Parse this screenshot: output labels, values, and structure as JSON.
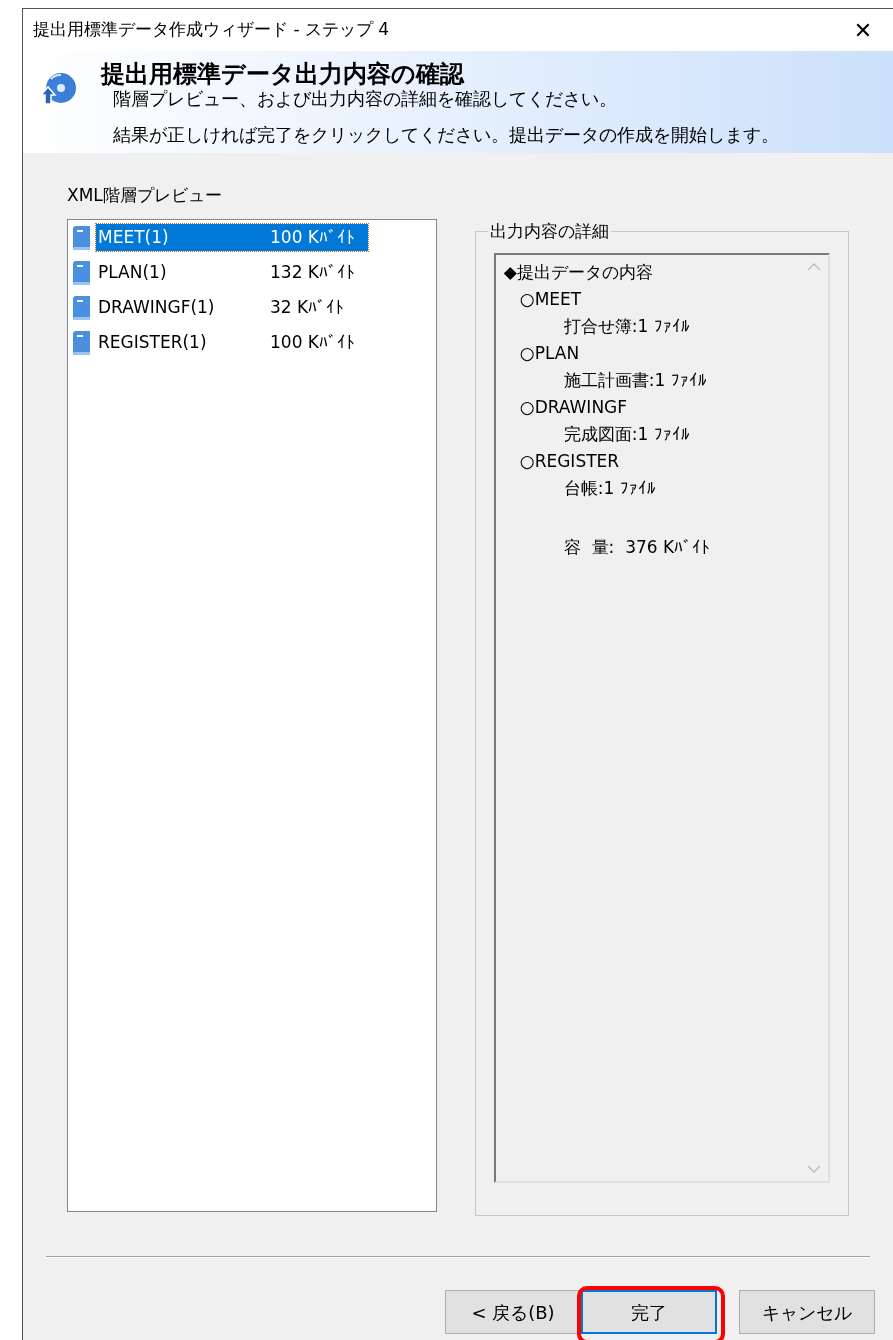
{
  "window": {
    "title": "提出用標準データ作成ウィザード - ステップ 4",
    "close": "✕"
  },
  "header": {
    "title": "提出用標準データ出力内容の確認",
    "lines": [
      "階層プレビュー、および出力内容の詳細を確認してください。",
      "結果が正しければ完了をクリックしてください。提出データの作成を開始します。"
    ]
  },
  "tree": {
    "label": "XML階層プレビュー",
    "items": [
      {
        "name": "MEET(1)",
        "size": "100 Kﾊﾞｲﾄ",
        "selected": true
      },
      {
        "name": "PLAN(1)",
        "size": "132 Kﾊﾞｲﾄ",
        "selected": false
      },
      {
        "name": "DRAWINGF(1)",
        "size": "32 Kﾊﾞｲﾄ",
        "selected": false
      },
      {
        "name": "REGISTER(1)",
        "size": "100 Kﾊﾞｲﾄ",
        "selected": false
      }
    ]
  },
  "details": {
    "label": "出力内容の詳細",
    "lines": [
      {
        "kind": "heading",
        "text": "◆提出データの内容"
      },
      {
        "kind": "group",
        "text": "○MEET"
      },
      {
        "kind": "item",
        "text": "打合せ簿:1 ﾌｧｲﾙ"
      },
      {
        "kind": "group",
        "text": "○PLAN"
      },
      {
        "kind": "item",
        "text": "施工計画書:1 ﾌｧｲﾙ"
      },
      {
        "kind": "group",
        "text": "○DRAWINGF"
      },
      {
        "kind": "item",
        "text": "完成図面:1 ﾌｧｲﾙ"
      },
      {
        "kind": "group",
        "text": "○REGISTER"
      },
      {
        "kind": "item",
        "text": "台帳:1 ﾌｧｲﾙ"
      },
      {
        "kind": "total",
        "text": "容  量:  376 Kﾊﾞｲﾄ"
      }
    ]
  },
  "buttons": [
    {
      "label": "< 戻る(B)",
      "default": false,
      "highlighted": false
    },
    {
      "label": "完了",
      "default": true,
      "highlighted": true
    },
    {
      "label": "キャンセル",
      "default": false,
      "highlighted": false
    }
  ]
}
